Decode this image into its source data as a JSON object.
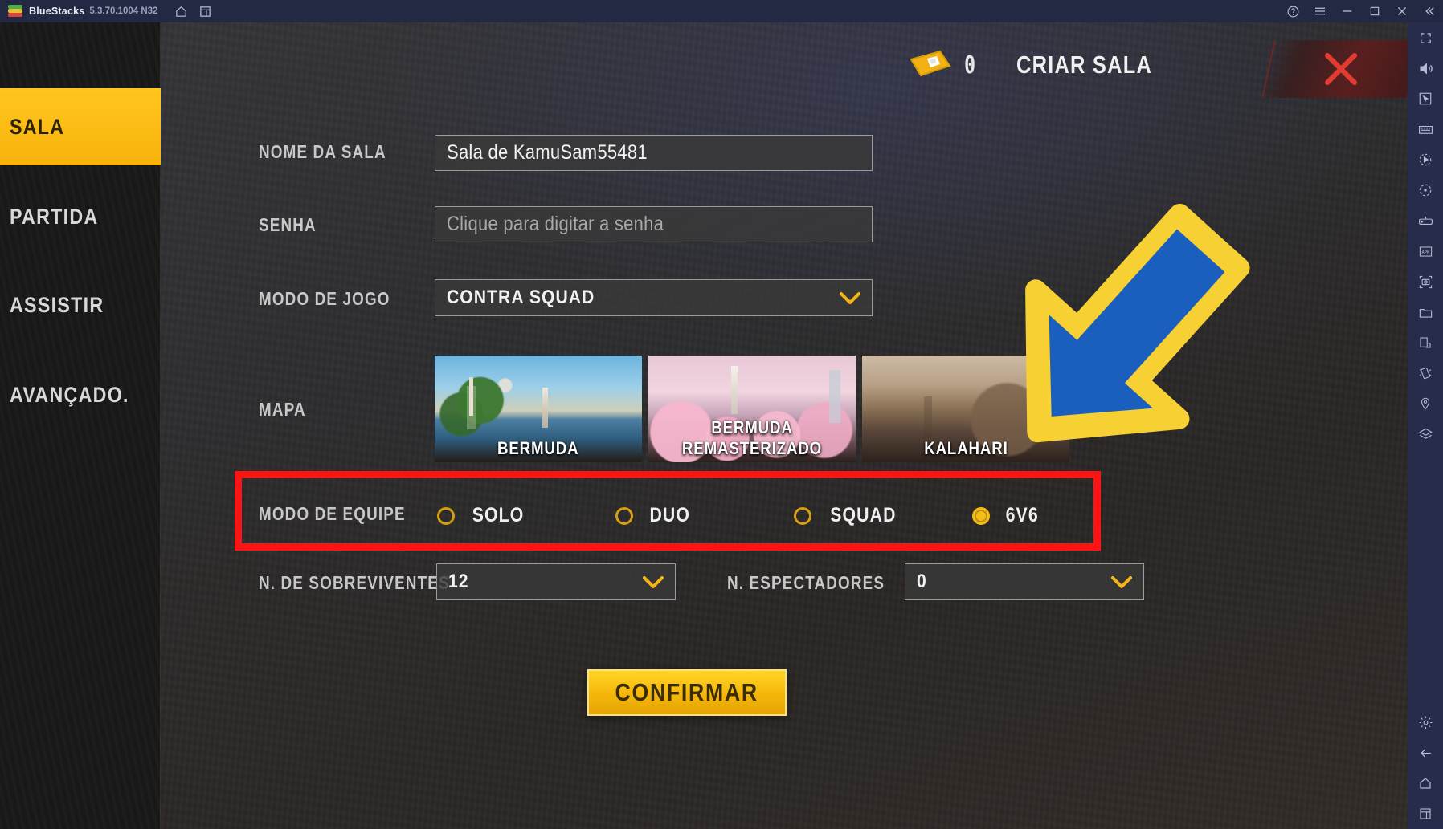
{
  "titlebar": {
    "app_name": "BlueStacks",
    "version": "5.3.70.1004 N32",
    "left_icons": [
      {
        "name": "home-icon"
      },
      {
        "name": "multi-instance-icon"
      }
    ],
    "right_icons": [
      {
        "name": "help-icon"
      },
      {
        "name": "menu-icon"
      },
      {
        "name": "minimize-icon"
      },
      {
        "name": "maximize-icon"
      },
      {
        "name": "close-icon"
      },
      {
        "name": "collapse-icon"
      }
    ]
  },
  "right_toolbar": {
    "icons": [
      {
        "name": "fullscreen-icon"
      },
      {
        "name": "volume-icon"
      },
      {
        "name": "cursor-icon"
      },
      {
        "name": "keyboard-controls-icon"
      },
      {
        "name": "macro-record-icon"
      },
      {
        "name": "rotate-icon"
      },
      {
        "name": "gamepad-icon"
      },
      {
        "name": "install-apk-icon"
      },
      {
        "name": "screenshot-icon"
      },
      {
        "name": "media-folder-icon"
      },
      {
        "name": "copy-to-pc-icon"
      },
      {
        "name": "shake-icon"
      },
      {
        "name": "location-icon"
      },
      {
        "name": "layers-icon"
      },
      {
        "name": "settings-gear-icon"
      },
      {
        "name": "back-arrow-icon"
      },
      {
        "name": "android-home-icon"
      },
      {
        "name": "recent-apps-icon"
      }
    ]
  },
  "header": {
    "ticket_icon": "room-card-ticket-icon",
    "ticket_count": "0",
    "title": "CRIAR SALA",
    "close_icon": "close-x-icon"
  },
  "sidebar": {
    "items": [
      {
        "label": "SALA",
        "active": true
      },
      {
        "label": "PARTIDA",
        "active": false
      },
      {
        "label": "ASSISTIR",
        "active": false
      },
      {
        "label": "AVANÇADO.",
        "active": false
      }
    ]
  },
  "form": {
    "room_name": {
      "label": "NOME DA SALA",
      "value": "Sala de KamuSam55481"
    },
    "password": {
      "label": "SENHA",
      "placeholder": "Clique para digitar a senha",
      "value": ""
    },
    "game_mode": {
      "label": "MODO DE JOGO",
      "value": "CONTRA SQUAD"
    },
    "map": {
      "label": "MAPA",
      "options": [
        {
          "name": "BERMUDA",
          "selected": false
        },
        {
          "name": "BERMUDA REMASTERIZADO",
          "selected": true
        },
        {
          "name": "KALAHARI",
          "selected": false
        }
      ]
    },
    "team_mode": {
      "label": "MODO DE EQUIPE",
      "options": [
        {
          "label": "SOLO",
          "selected": false
        },
        {
          "label": "DUO",
          "selected": false
        },
        {
          "label": "SQUAD",
          "selected": false
        },
        {
          "label": "6V6",
          "selected": true
        }
      ]
    },
    "survivors": {
      "label": "N. DE SOBREVIVENTES",
      "value": "12"
    },
    "spectators": {
      "label": "N. ESPECTADORES",
      "value": "0"
    },
    "confirm_label": "CONFIRMAR"
  },
  "annotations": {
    "highlight_box_color": "#fa1414",
    "arrow_outline_color": "#f7d034",
    "arrow_fill_color": "#1b5fbe"
  },
  "colors": {
    "accent_gold": "#f5b516",
    "titlebar_bg": "#242943",
    "toolbar_bg": "#272c4a",
    "nav_bg": "#191919"
  }
}
